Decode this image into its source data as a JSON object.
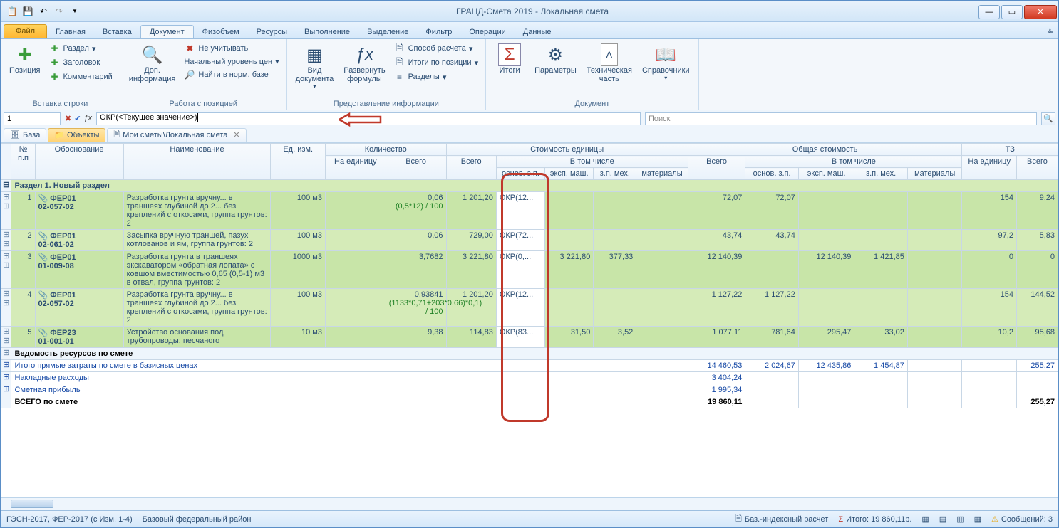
{
  "title": "ГРАНД-Смета 2019 - Локальная смета",
  "tabs": {
    "file": "Файл",
    "items": [
      "Главная",
      "Вставка",
      "Документ",
      "Физобъем",
      "Ресурсы",
      "Выполнение",
      "Выделение",
      "Фильтр",
      "Операции",
      "Данные"
    ],
    "active": "Документ"
  },
  "ribbon": {
    "g1_label": "Вставка строки",
    "g1_position": "Позиция",
    "g1_razdel": "Раздел",
    "g1_zagolovok": "Заголовок",
    "g1_comment": "Комментарий",
    "g2_label": "Работа с позицией",
    "g2_dopinfo": "Доп.\nинформация",
    "g2_ne_uchit": "Не учитывать",
    "g2_nachurov": "Начальный уровень цен",
    "g2_naiti": "Найти в норм. базе",
    "g3_label": "Представление информации",
    "g3_viddok": "Вид\nдокумента",
    "g3_razvernut": "Развернуть\nформулы",
    "g3_sposob": "Способ расчета",
    "g3_itogipoz": "Итоги по позиции",
    "g3_razdely": "Разделы",
    "g4_label": "Документ",
    "g4_itogi": "Итоги",
    "g4_param": "Параметры",
    "g4_tech": "Техническая\nчасть",
    "g4_sprav": "Справочники"
  },
  "formula": {
    "cell": "1",
    "value": "ОКР(<Текущее значение>)",
    "search_placeholder": "Поиск"
  },
  "doctabs": {
    "baza": "База",
    "objects": "Объекты",
    "path": "Мои сметы\\Локальная смета"
  },
  "headers": {
    "num": "№ п.п",
    "obos": "Обоснование",
    "naim": "Наименование",
    "ed": "Ед. изм.",
    "kol": "Количество",
    "kol_ed": "На единицу",
    "kol_vsego": "Всего",
    "stoim_ed": "Стоимость единицы",
    "se_vsego": "Всего",
    "v_tom": "В том числе",
    "osnov_zp": "основ. з.п.",
    "eksp_mash": "эксп. маш.",
    "zp_mex": "з.п. мех.",
    "mat": "материалы",
    "obsh": "Общая стоимость",
    "tz": "ТЗ",
    "tz_ed": "На единицу",
    "tz_vsego": "Всего"
  },
  "section": "Раздел 1. Новый раздел",
  "rows": [
    {
      "n": "1",
      "code": "ФЕР01\n02-057-02",
      "name": "Разработка грунта вручну... в траншеях глубиной до 2... без креплений с откосами, группа грунтов: 2",
      "ed": "100 м3",
      "kol_vsego": "0,06",
      "kol_frm": "(0,5*12) / 100",
      "se_vsego": "1 201,20",
      "okr": "ОКР(12...",
      "o_vsego": "72,07",
      "o_ozp": "72,07",
      "tz_ed": "154",
      "tz_vs": "9,24"
    },
    {
      "n": "2",
      "code": "ФЕР01\n02-061-02",
      "name": "Засыпка вручную траншей, пазух котлованов и ям, группа грунтов: 2",
      "ed": "100 м3",
      "kol_vsego": "0,06",
      "se_vsego": "729,00",
      "okr": "ОКР(72...",
      "o_vsego": "43,74",
      "o_ozp": "43,74",
      "tz_ed": "97,2",
      "tz_vs": "5,83"
    },
    {
      "n": "3",
      "code": "ФЕР01\n01-009-08",
      "name": "Разработка грунта в траншеях экскаватором «обратная лопата» с ковшом вместимостью 0,65 (0,5-1) м3 в отвал, группа грунтов: 2",
      "ed": "1000 м3",
      "kol_vsego": "3,7682",
      "se_vsego": "3 221,80",
      "okr": "ОКР(0,...",
      "eksp": "3 221,80",
      "zpmex": "377,33",
      "o_vsego": "12 140,39",
      "o_eksp": "12 140,39",
      "o_zpmex": "1 421,85",
      "tz_ed": "0",
      "tz_vs": "0"
    },
    {
      "n": "4",
      "code": "ФЕР01\n02-057-02",
      "name": "Разработка грунта вручну... в траншеях глубиной до 2... без креплений с откосами, группа грунтов: 2",
      "ed": "100 м3",
      "kol_vsego": "0,93841",
      "kol_frm": "(1133*0,71+203*0,66)*0,1) / 100",
      "se_vsego": "1 201,20",
      "okr": "ОКР(12...",
      "o_vsego": "1 127,22",
      "o_ozp": "1 127,22",
      "tz_ed": "154",
      "tz_vs": "144,52"
    },
    {
      "n": "5",
      "code": "ФЕР23\n01-001-01",
      "name": "Устройство основания под трубопроводы: песчаного",
      "ed": "10 м3",
      "kol_vsego": "9,38",
      "se_vsego": "114,83",
      "okr": "ОКР(83...",
      "eksp": "31,50",
      "zpmex": "3,52",
      "o_vsego": "1 077,11",
      "o_ozp": "781,64",
      "o_eksp": "295,47",
      "o_zpmex": "33,02",
      "tz_ed": "10,2",
      "tz_vs": "95,68"
    }
  ],
  "vedomost": "Ведомость ресурсов по смете",
  "totals": [
    {
      "name": "Итого прямые затраты по смете в базисных ценах",
      "vsego": "14 460,53",
      "ozp": "2 024,67",
      "eksp": "12 435,86",
      "zpmex": "1 454,87",
      "tz": "255,27"
    },
    {
      "name": "Накладные расходы",
      "vsego": "3 404,24"
    },
    {
      "name": "Сметная прибыль",
      "vsego": "1 995,34"
    }
  ],
  "grand": {
    "name": "ВСЕГО по смете",
    "vsego": "19 860,11",
    "tz": "255,27"
  },
  "status": {
    "left1": "ГЭСН-2017, ФЕР-2017 (с Изм. 1-4)",
    "left2": "Базовый федеральный район",
    "calc": "Баз.-индексный расчет",
    "itogo": "Итого: 19 860,11р.",
    "msg": "Сообщений: 3"
  }
}
